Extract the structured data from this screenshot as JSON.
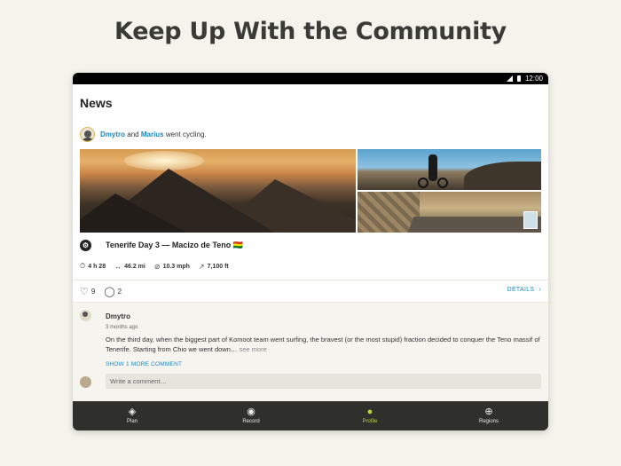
{
  "headline": "Keep Up With the Community",
  "statusbar": {
    "time": "12:00"
  },
  "news": {
    "title": "News"
  },
  "activity": {
    "user1": "Dmytro",
    "connector": "and",
    "user2": "Marius",
    "action": "went cycling.",
    "tour_title": "Tenerife Day 3 — Macizo de Teno 🇧🇴",
    "stats": {
      "duration": "4 h 28",
      "distance": "46.2 mi",
      "speed": "10.3 mph",
      "elevation": "7,100 ft"
    },
    "likes": "9",
    "comments_count": "2",
    "details_label": "DETAILS"
  },
  "comment": {
    "author": "Dmytro",
    "time": "3 months ago",
    "text": "On the third day, when the biggest part of Komoot team went surfing, the bravest (or the most stupid) fraction decided to conquer the Teno massif of Tenerife. Starting from Chio we went down…",
    "see_more": "see more",
    "show_more": "SHOW 1 MORE COMMENT",
    "input_placeholder": "Write a comment…"
  },
  "nav": {
    "items": [
      {
        "label": "Plan",
        "icon": "plan-diamond-icon"
      },
      {
        "label": "Record",
        "icon": "record-icon"
      },
      {
        "label": "Profile",
        "icon": "profile-icon"
      },
      {
        "label": "Regions",
        "icon": "globe-icon"
      }
    ],
    "active_color": "#b6d43b"
  },
  "colors": {
    "link": "#1a88c9",
    "background": "#f4f3ec",
    "navbar": "#2f2f2c"
  }
}
